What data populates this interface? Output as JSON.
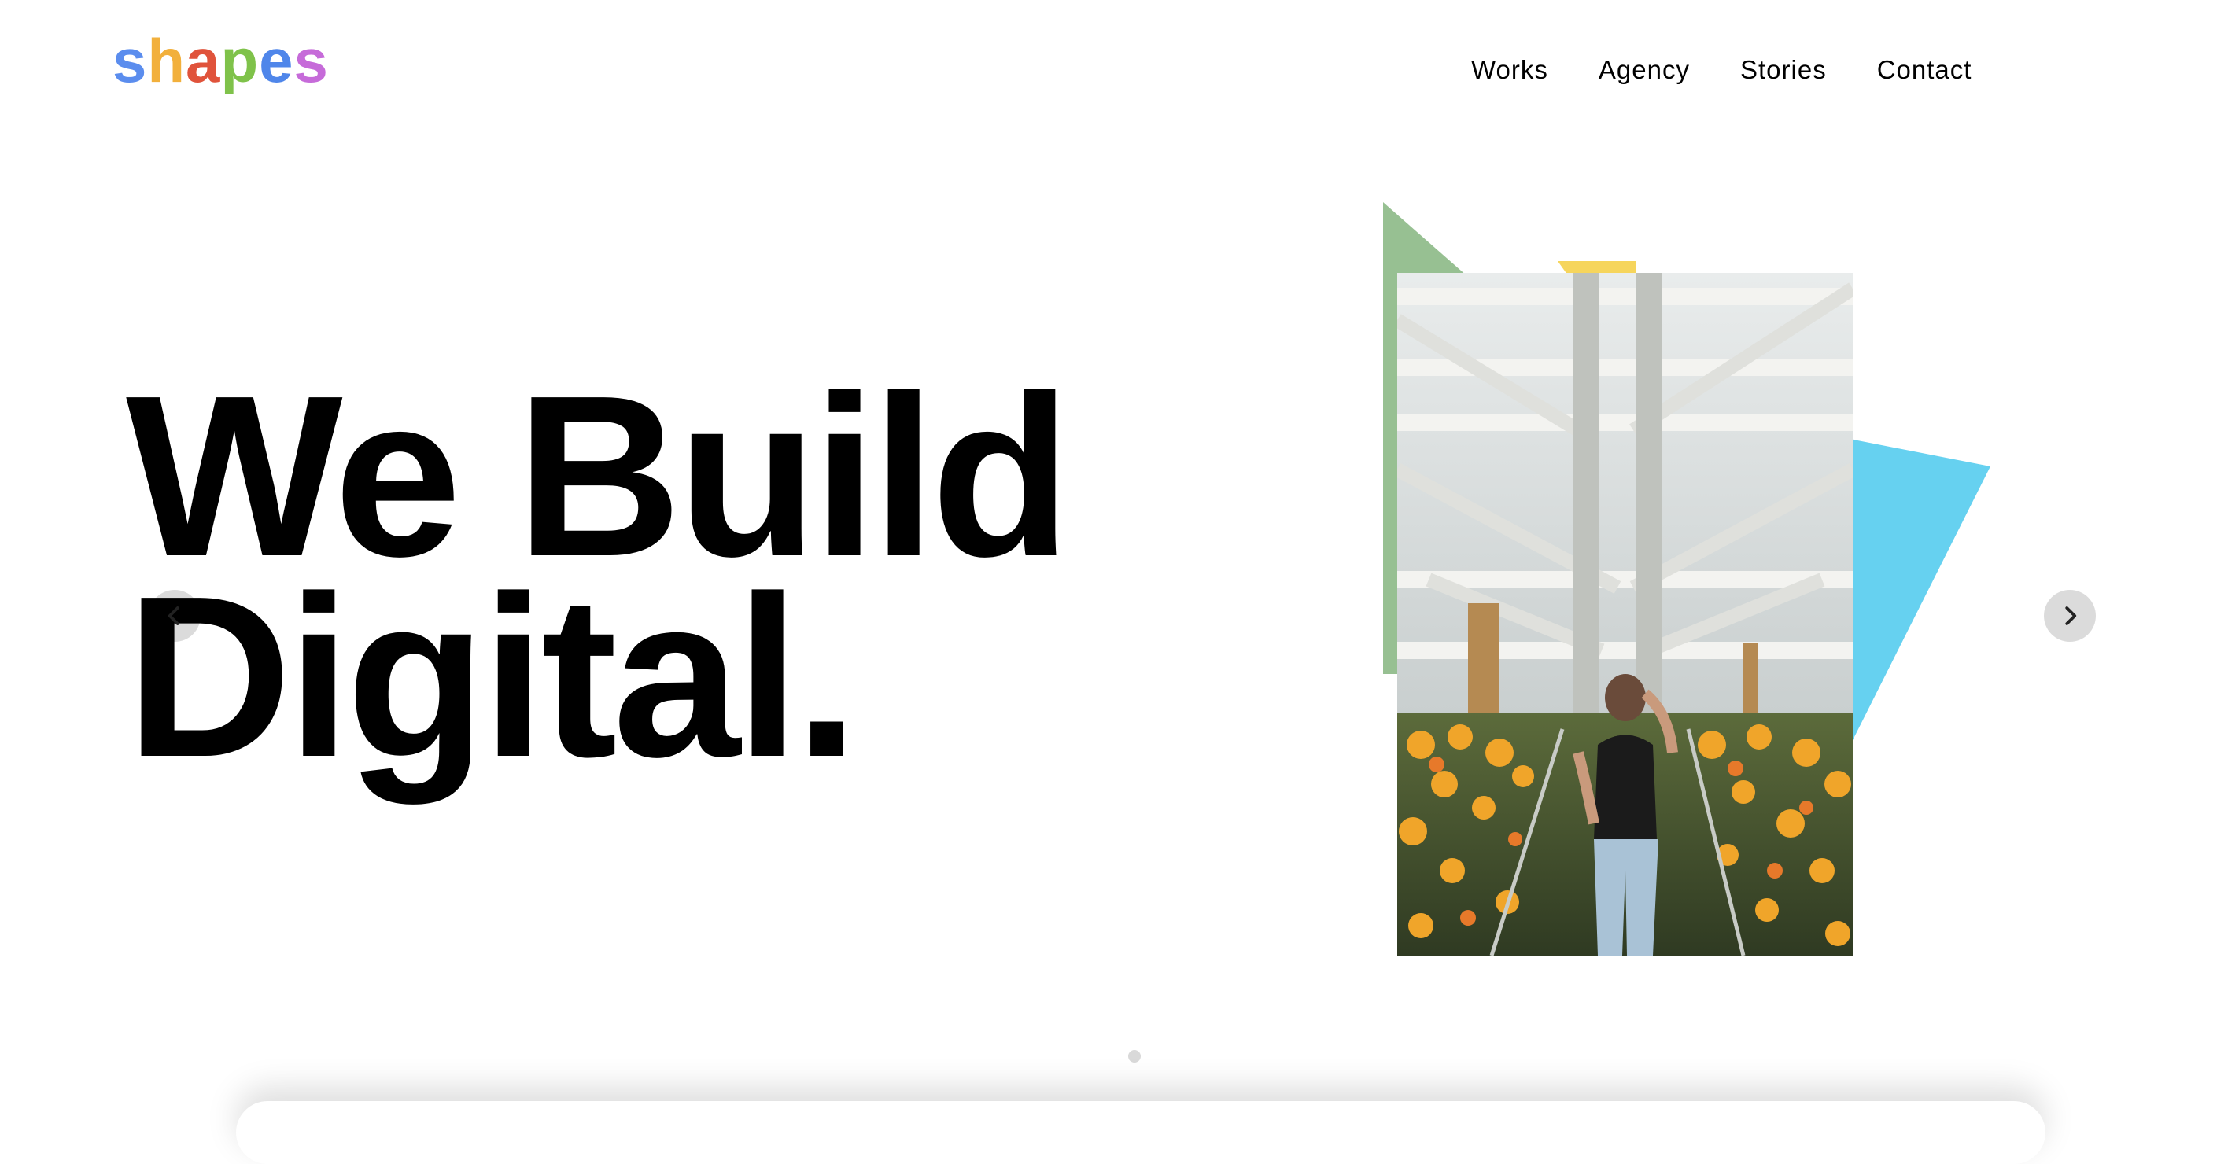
{
  "brand": {
    "letters": [
      {
        "char": "s",
        "color": "#5b8dee"
      },
      {
        "char": "h",
        "color": "#f2b03c"
      },
      {
        "char": "a",
        "color": "#e0533b"
      },
      {
        "char": "p",
        "color": "#7fc24a"
      },
      {
        "char": "e",
        "color": "#4f86ea"
      },
      {
        "char": "s",
        "color": "#c66bd9"
      }
    ]
  },
  "nav": {
    "items": [
      {
        "label": "Works"
      },
      {
        "label": "Agency"
      },
      {
        "label": "Stories"
      },
      {
        "label": "Contact"
      }
    ]
  },
  "hero": {
    "line1": "We Build",
    "line2": "Digital."
  },
  "slider": {
    "prev_icon": "chevron-left-icon",
    "next_icon": "chevron-right-icon",
    "slide_count": 1,
    "active_slide": 1
  },
  "art": {
    "shape_colors": {
      "green": "#97c092",
      "yellow": "#f6d55c",
      "blue": "#66d1f0"
    },
    "photo_subject": "woman walking in greenhouse with orange flowers"
  }
}
